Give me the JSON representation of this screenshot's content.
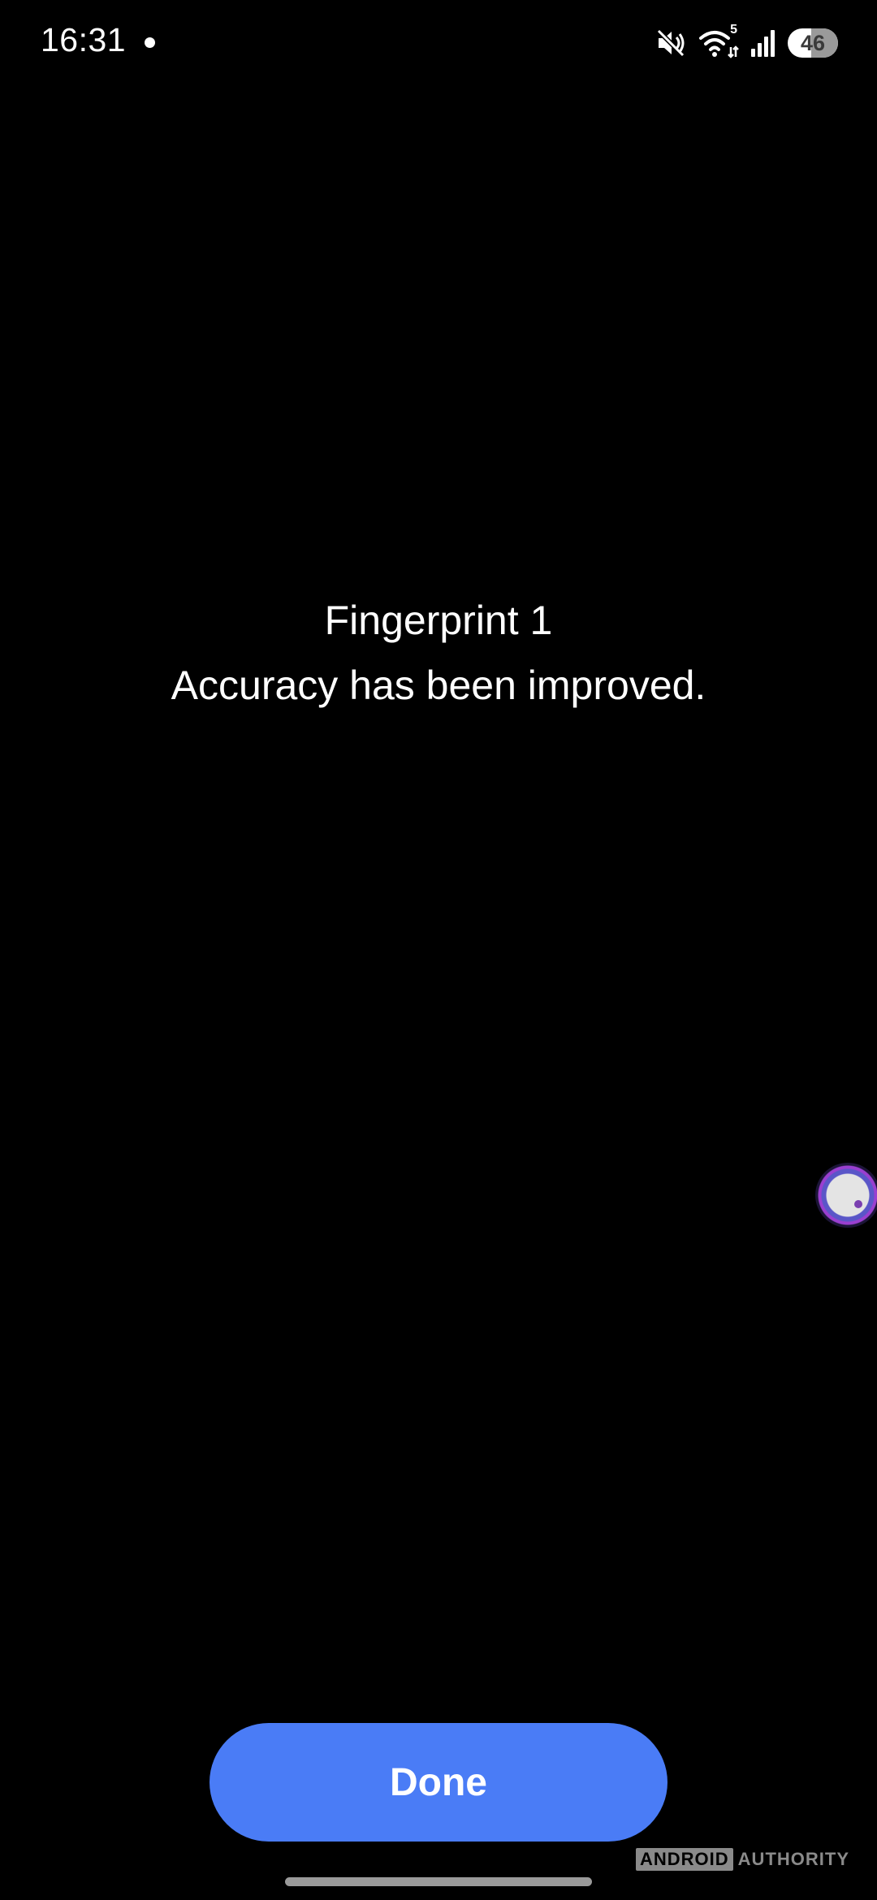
{
  "status_bar": {
    "time": "16:31",
    "battery_level": "46",
    "battery_fraction": 0.46,
    "wifi_badge": "5",
    "icons": [
      "notification-dot-icon",
      "mute-icon",
      "wifi-icon",
      "cell-signal-icon",
      "battery-icon"
    ]
  },
  "message": {
    "title": "Fingerprint 1",
    "subtitle": "Accuracy has been improved."
  },
  "actions": {
    "done_label": "Done"
  },
  "watermark": {
    "brand_box": "ANDROID",
    "brand_text": "AUTHORITY"
  },
  "colors": {
    "background": "#000000",
    "accent_button": "#4a7cf6",
    "text": "#ffffff"
  }
}
